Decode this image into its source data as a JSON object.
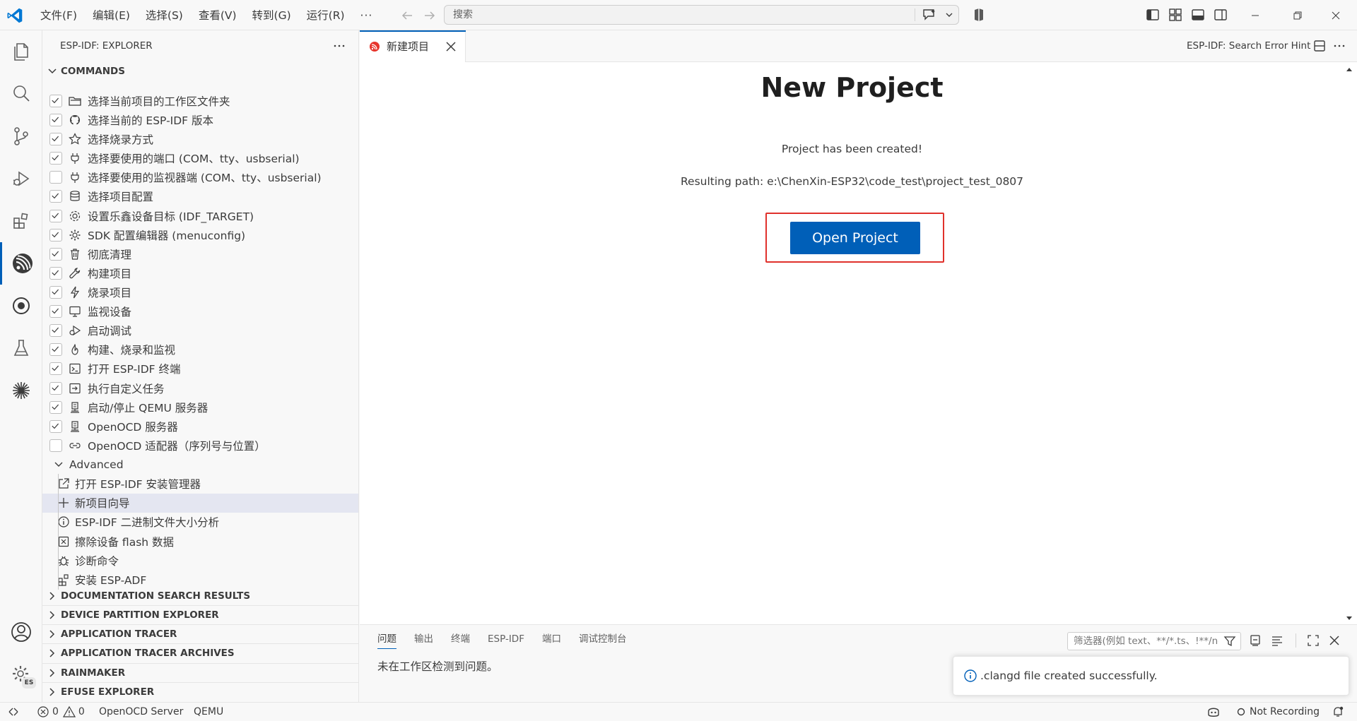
{
  "menu": {
    "items": [
      "文件(F)",
      "编辑(E)",
      "选择(S)",
      "查看(V)",
      "转到(G)",
      "运行(R)"
    ],
    "more": "···"
  },
  "command_center": {
    "placeholder": "搜索"
  },
  "sidebar": {
    "title": "ESP-IDF: EXPLORER",
    "more": "···",
    "commands_section": "COMMANDS",
    "commands": [
      {
        "label": "选择当前项目的工作区文件夹",
        "checked": true,
        "icon": "folder-icon"
      },
      {
        "label": "选择当前的 ESP-IDF 版本",
        "checked": true,
        "icon": "github-icon"
      },
      {
        "label": "选择烧录方式",
        "checked": true,
        "icon": "star-icon"
      },
      {
        "label": "选择要使用的端口 (COM、tty、usbserial)",
        "checked": true,
        "icon": "plug-icon"
      },
      {
        "label": "选择要使用的监视器端 (COM、tty、usbserial)",
        "checked": false,
        "icon": "plug-icon"
      },
      {
        "label": "选择项目配置",
        "checked": true,
        "icon": "database-icon"
      },
      {
        "label": "设置乐鑫设备目标 (IDF_TARGET)",
        "checked": true,
        "icon": "chip-gear-icon"
      },
      {
        "label": "SDK 配置编辑器 (menuconfig)",
        "checked": true,
        "icon": "gear-icon"
      },
      {
        "label": "彻底清理",
        "checked": true,
        "icon": "trash-icon"
      },
      {
        "label": "构建项目",
        "checked": true,
        "icon": "wrench-icon"
      },
      {
        "label": "烧录项目",
        "checked": true,
        "icon": "lightning-icon"
      },
      {
        "label": "监视设备",
        "checked": true,
        "icon": "monitor-icon"
      },
      {
        "label": "启动调试",
        "checked": true,
        "icon": "debug-icon"
      },
      {
        "label": "构建、烧录和监视",
        "checked": true,
        "icon": "flame-icon"
      },
      {
        "label": "打开 ESP-IDF 终端",
        "checked": true,
        "icon": "terminal-icon"
      },
      {
        "label": "执行自定义任务",
        "checked": true,
        "icon": "run-task-icon"
      },
      {
        "label": "启动/停止 QEMU 服务器",
        "checked": true,
        "icon": "server-icon"
      },
      {
        "label": "OpenOCD 服务器",
        "checked": true,
        "icon": "server-icon"
      },
      {
        "label": "OpenOCD 适配器（序列号与位置）",
        "checked": false,
        "icon": "link-icon"
      }
    ],
    "advanced_label": "Advanced",
    "advanced": [
      {
        "label": "打开 ESP-IDF 安装管理器",
        "icon": "link-external-icon"
      },
      {
        "label": "新项目向导",
        "icon": "add-icon",
        "selected": true
      },
      {
        "label": "ESP-IDF 二进制文件大小分析",
        "icon": "info-icon"
      },
      {
        "label": "擦除设备 flash 数据",
        "icon": "erase-icon"
      },
      {
        "label": "诊断命令",
        "icon": "bug-icon"
      },
      {
        "label": "安装 ESP-ADF",
        "icon": "extensions-icon"
      }
    ],
    "sections": [
      "DOCUMENTATION SEARCH RESULTS",
      "DEVICE PARTITION EXPLORER",
      "APPLICATION TRACER",
      "APPLICATION TRACER ARCHIVES",
      "RAINMAKER",
      "EFUSE EXPLORER"
    ]
  },
  "editor": {
    "tab_label": "新建项目",
    "actions_label": "ESP-IDF: Search Error Hint",
    "title": "New Project",
    "message": "Project has been created!",
    "path": "Resulting path: e:\\ChenXin-ESP32\\code_test\\project_test_0807",
    "button": "Open Project"
  },
  "panel": {
    "tabs": [
      "问题",
      "输出",
      "终端",
      "ESP-IDF",
      "端口",
      "调试控制台"
    ],
    "filter_placeholder": "筛选器(例如 text、**/*.ts、!**/node_modules/**)",
    "body": "未在工作区检测到问题。"
  },
  "toast": {
    "message": ".clangd file created successfully."
  },
  "activity_badge": "ES",
  "statusbar": {
    "errors": "0",
    "warnings": "0",
    "openocd": "OpenOCD Server",
    "qemu": "QEMU",
    "recording": "Not Recording"
  },
  "colors": {
    "accent": "#005fb8",
    "highlight_box": "#e0312c"
  }
}
